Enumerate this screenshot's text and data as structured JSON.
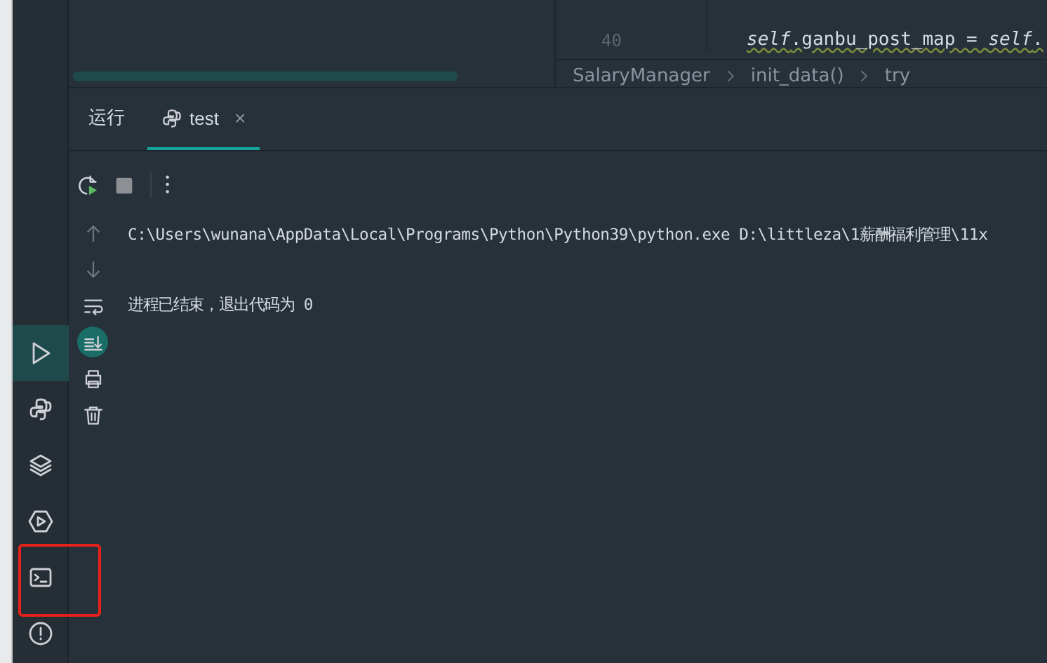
{
  "editor": {
    "line_number": "40",
    "code": "*self*.ganbu_post_map = *self*.",
    "breadcrumb": [
      "SalaryManager",
      "init_data()",
      "try"
    ]
  },
  "tool_window_bar": [
    {
      "kind": "run",
      "selected": true,
      "annotated": false
    },
    {
      "kind": "python",
      "selected": false,
      "annotated": false
    },
    {
      "kind": "layers",
      "selected": false,
      "annotated": false
    },
    {
      "kind": "services",
      "selected": false,
      "annotated": false
    },
    {
      "kind": "terminal",
      "selected": false,
      "annotated": true
    },
    {
      "kind": "problems",
      "selected": false,
      "annotated": false
    }
  ],
  "run_panel": {
    "tabs": [
      {
        "label": "运行",
        "kind": "title",
        "selected": false
      },
      {
        "label": "test",
        "kind": "python",
        "selected": true,
        "close": "×"
      }
    ],
    "toolbar": [
      {
        "kind": "rerun"
      },
      {
        "kind": "stop"
      },
      {
        "kind": "more"
      }
    ],
    "gutter": [
      {
        "kind": "up",
        "on": false
      },
      {
        "kind": "down",
        "on": false
      },
      {
        "kind": "wrap",
        "on": false
      },
      {
        "kind": "scroll-end",
        "on": true
      },
      {
        "kind": "print",
        "on": false
      },
      {
        "kind": "trash",
        "on": false
      }
    ],
    "console": [
      "C:\\Users\\wunana\\AppData\\Local\\Programs\\Python\\Python39\\python.exe D:\\littleza\\1薪酬福利管理\\11x",
      "进程已结束，退出代码为 0"
    ]
  }
}
